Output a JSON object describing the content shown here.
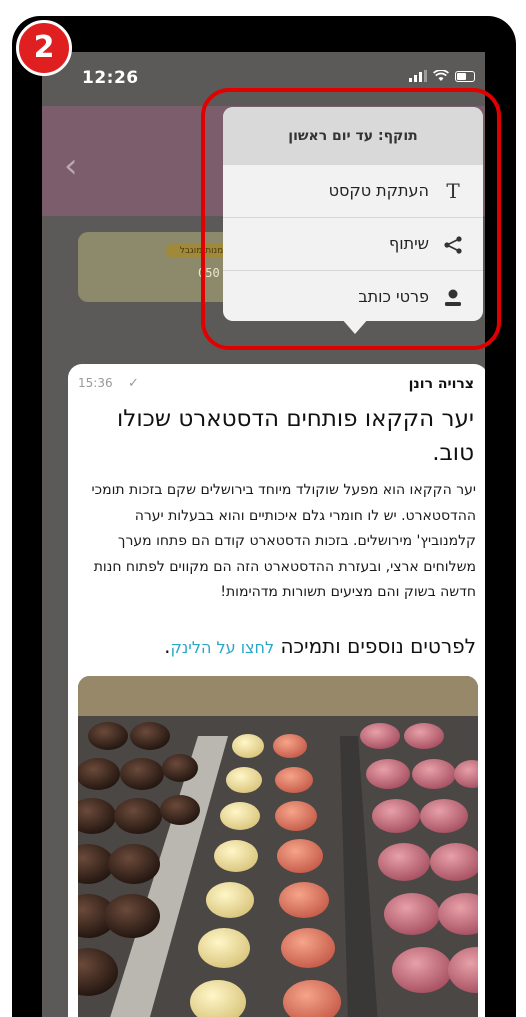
{
  "step_badge": "2",
  "status_bar": {
    "time": "12:26"
  },
  "chat_header": {
    "back_icon": "chevron-left-icon"
  },
  "dimmed_card": {
    "badge_text": "לי הזמנות מוגבל",
    "number_text": "050 124"
  },
  "message": {
    "sender": "צרויה רונן",
    "time": "15:36",
    "headline": "יער הקקאו פותחים הדסטארט שכולו טוב.",
    "body": "יער הקקאו הוא מפעל שוקולד מיוחד בירושלים שקם בזכות תומכי ההדסטארט. יש לו חומרי גלם איכותיים והוא בבעלות יערה קלמנוביץ' מירושלים. בזכות הדסטארט קודם הם פתחו מערך משלוחים ארצי, ובעזרת ההדסטארט הזה הם מקווים לפתוח חנות חדשה בשוק והם מציעים תשורות מדהימות!",
    "cta_text": "לפרטים נוספים ותמיכה",
    "cta_link": "לחצו על הלינק",
    "cta_period": "."
  },
  "context_menu": {
    "header": "תוקף: עד יום ראשון",
    "items": [
      {
        "label": "העתקת טקסט",
        "icon": "text-icon"
      },
      {
        "label": "שיתוף",
        "icon": "share-icon"
      },
      {
        "label": "פרטי כותב",
        "icon": "person-icon"
      }
    ]
  }
}
